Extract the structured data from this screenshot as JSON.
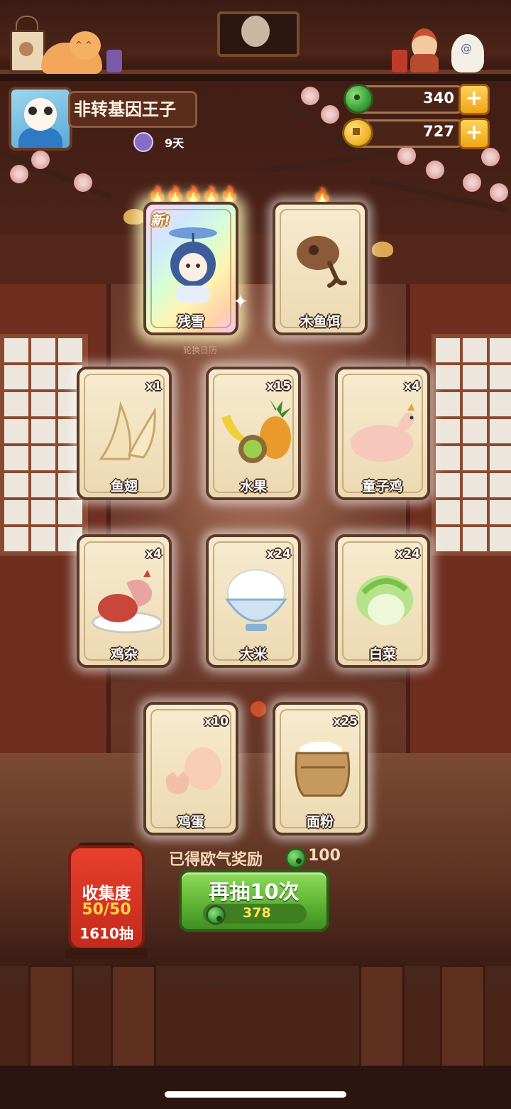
{
  "player": {
    "name": "非转基因王子",
    "days": "9天"
  },
  "currency": {
    "jade": "340",
    "coins": "727"
  },
  "cards": [
    {
      "id": "cancanxue",
      "label": "残雪",
      "count": "",
      "rarity_flames": 5,
      "new": "新!",
      "rare": true
    },
    {
      "id": "muyuer",
      "label": "木鱼饵",
      "count": "",
      "rarity_flames": 1,
      "new": "",
      "rare": false
    },
    {
      "id": "yuchi",
      "label": "鱼翅",
      "count": "x1"
    },
    {
      "id": "shuiguo",
      "label": "水果",
      "count": "x15"
    },
    {
      "id": "tongziji",
      "label": "童子鸡",
      "count": "x4"
    },
    {
      "id": "jiza",
      "label": "鸡杂",
      "count": "x4"
    },
    {
      "id": "dami",
      "label": "大米",
      "count": "x24"
    },
    {
      "id": "baicai",
      "label": "白菜",
      "count": "x24"
    },
    {
      "id": "jidan",
      "label": "鸡蛋",
      "count": "x10"
    },
    {
      "id": "mianfen",
      "label": "面粉",
      "count": "x25"
    }
  ],
  "background": {
    "rotate_label": "轮换日历"
  },
  "reward": {
    "label": "已得欧气奖励",
    "value": "100"
  },
  "draw_button": {
    "label": "再抽10次",
    "cost": "378"
  },
  "collection": {
    "label": "收集度",
    "progress": "50/50",
    "draws": "1610抽"
  },
  "colors": {
    "accent_green": "#5fb436",
    "lantern_red": "#d8362a",
    "card_cream": "#f3e4c4"
  }
}
